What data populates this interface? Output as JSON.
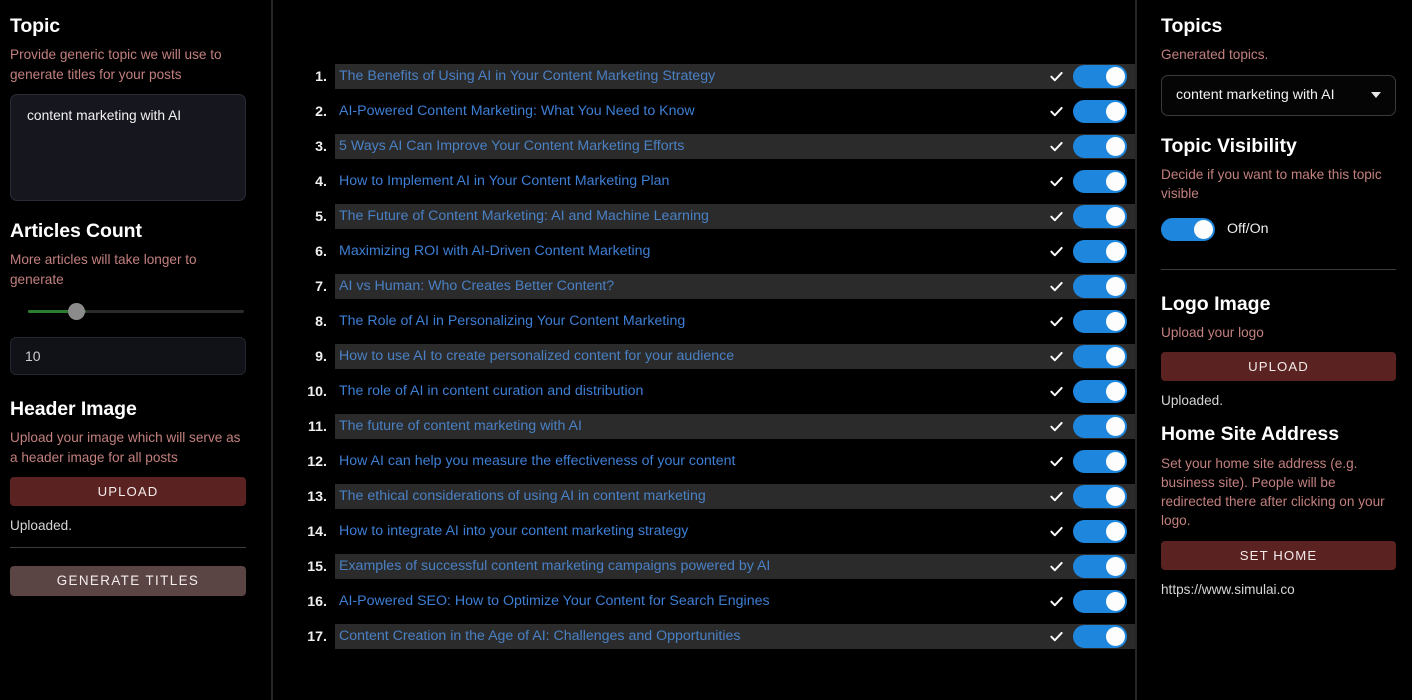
{
  "left_sidebar": {
    "topic": {
      "heading": "Topic",
      "help": "Provide generic topic we will use to generate titles for your posts",
      "value": "content marketing with AI",
      "placeholder": "Topic"
    },
    "articles_count": {
      "heading": "Articles Count",
      "help": "More articles will take longer to generate",
      "value": "10",
      "slider_percent": 25
    },
    "header_image": {
      "heading": "Header Image",
      "help": "Upload your image which will serve as a header image for all posts",
      "upload_label": "UPLOAD",
      "status": "Uploaded."
    },
    "generate_label": "GENERATE TITLES"
  },
  "titles": [
    {
      "n": "1.",
      "text": "The Benefits of Using AI in Your Content Marketing Strategy",
      "checked": true,
      "enabled": true
    },
    {
      "n": "2.",
      "text": "AI-Powered Content Marketing: What You Need to Know",
      "checked": true,
      "enabled": true
    },
    {
      "n": "3.",
      "text": "5 Ways AI Can Improve Your Content Marketing Efforts",
      "checked": true,
      "enabled": true
    },
    {
      "n": "4.",
      "text": "How to Implement AI in Your Content Marketing Plan",
      "checked": true,
      "enabled": true
    },
    {
      "n": "5.",
      "text": "The Future of Content Marketing: AI and Machine Learning",
      "checked": true,
      "enabled": true
    },
    {
      "n": "6.",
      "text": "Maximizing ROI with AI-Driven Content Marketing",
      "checked": true,
      "enabled": true
    },
    {
      "n": "7.",
      "text": "AI vs Human: Who Creates Better Content?",
      "checked": true,
      "enabled": true
    },
    {
      "n": "8.",
      "text": "The Role of AI in Personalizing Your Content Marketing",
      "checked": true,
      "enabled": true
    },
    {
      "n": "9.",
      "text": "How to use AI to create personalized content for your audience",
      "checked": true,
      "enabled": true
    },
    {
      "n": "10.",
      "text": "The role of AI in content curation and distribution",
      "checked": true,
      "enabled": true
    },
    {
      "n": "11.",
      "text": "The future of content marketing with AI",
      "checked": true,
      "enabled": true
    },
    {
      "n": "12.",
      "text": "How AI can help you measure the effectiveness of your content",
      "checked": true,
      "enabled": true
    },
    {
      "n": "13.",
      "text": "The ethical considerations of using AI in content marketing",
      "checked": true,
      "enabled": true
    },
    {
      "n": "14.",
      "text": "How to integrate AI into your content marketing strategy",
      "checked": true,
      "enabled": true
    },
    {
      "n": "15.",
      "text": "Examples of successful content marketing campaigns powered by AI",
      "checked": true,
      "enabled": true
    },
    {
      "n": "16.",
      "text": "AI-Powered SEO: How to Optimize Your Content for Search Engines",
      "checked": true,
      "enabled": true
    },
    {
      "n": "17.",
      "text": "Content Creation in the Age of AI: Challenges and Opportunities",
      "checked": true,
      "enabled": true
    }
  ],
  "right_sidebar": {
    "topics": {
      "heading": "Topics",
      "help": "Generated topics.",
      "selected": "content marketing with AI"
    },
    "topic_visibility": {
      "heading": "Topic Visibility",
      "help": "Decide if you want to make this topic visible",
      "toggle_label": "Off/On",
      "enabled": true
    },
    "logo_image": {
      "heading": "Logo Image",
      "help": "Upload your logo",
      "upload_label": "UPLOAD",
      "status": "Uploaded."
    },
    "home_site": {
      "heading": "Home Site Address",
      "help": "Set your home site address (e.g. business site). People will be redirected there after clicking on your logo.",
      "button_label": "SET HOME",
      "url": "https://www.simulai.co"
    }
  },
  "colors": {
    "background": "#000000",
    "toggle_on": "#1f86dd",
    "link": "#3d7fd4",
    "help_text": "#c2807e",
    "button_primary": "#5b2222",
    "button_generate": "#5b4444",
    "slider_fill": "#2b7d2f"
  }
}
